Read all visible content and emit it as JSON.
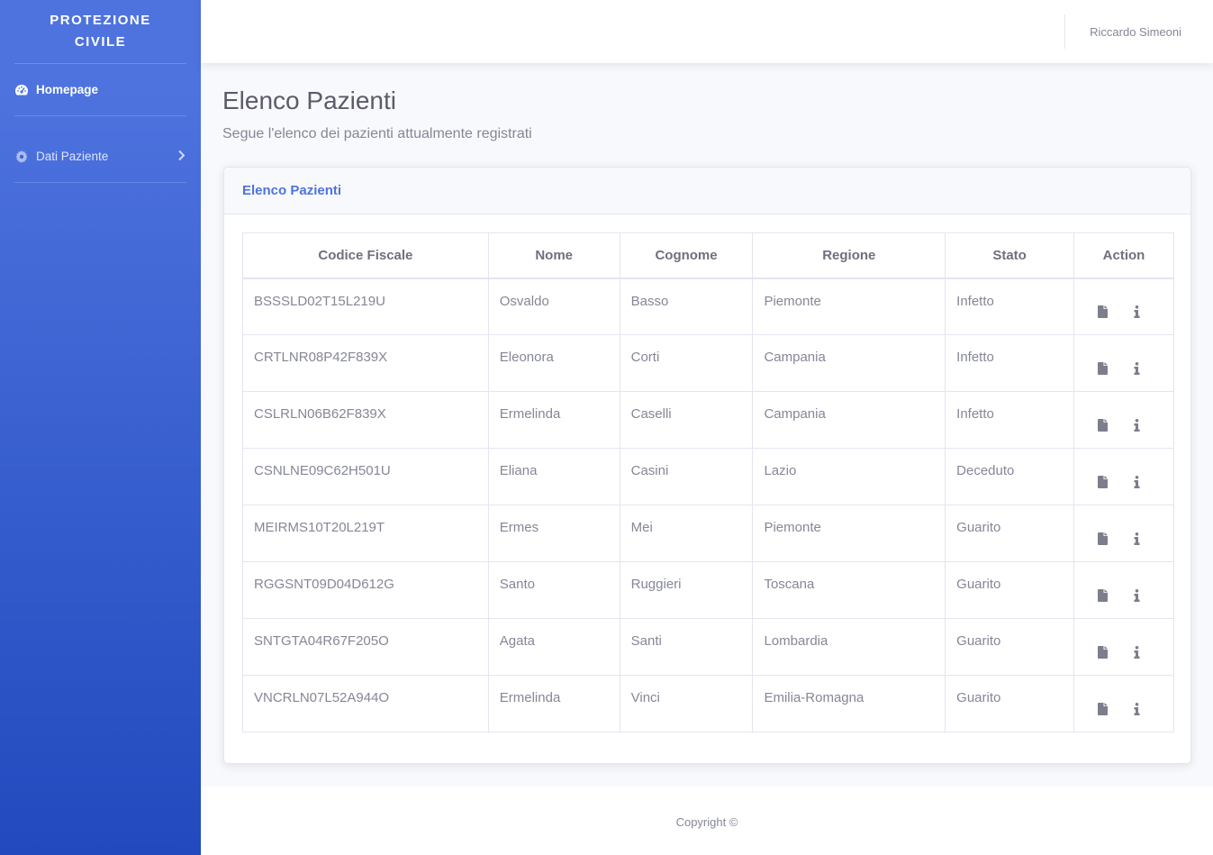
{
  "sidebar": {
    "brand_line1": "PROTEZIONE",
    "brand_line2": "CIVILE",
    "items": [
      {
        "label": "Homepage",
        "icon": "tachometer-icon"
      },
      {
        "label": "Dati Paziente",
        "icon": "gear-icon"
      }
    ]
  },
  "topbar": {
    "user_name": "Riccardo Simeoni"
  },
  "main": {
    "title": "Elenco Pazienti",
    "subtitle": "Segue l'elenco dei pazienti attualmente registrati",
    "card_title": "Elenco Pazienti"
  },
  "table": {
    "headers": [
      "Codice Fiscale",
      "Nome",
      "Cognome",
      "Regione",
      "Stato",
      "Action"
    ],
    "rows": [
      [
        "BSSSLD02T15L219U",
        "Osvaldo",
        "Basso",
        "Piemonte",
        "Infetto"
      ],
      [
        "CRTLNR08P42F839X",
        "Eleonora",
        "Corti",
        "Campania",
        "Infetto"
      ],
      [
        "CSLRLN06B62F839X",
        "Ermelinda",
        "Caselli",
        "Campania",
        "Infetto"
      ],
      [
        "CSNLNE09C62H501U",
        "Eliana",
        "Casini",
        "Lazio",
        "Deceduto"
      ],
      [
        "MEIRMS10T20L219T",
        "Ermes",
        "Mei",
        "Piemonte",
        "Guarito"
      ],
      [
        "RGGSNT09D04D612G",
        "Santo",
        "Ruggieri",
        "Toscana",
        "Guarito"
      ],
      [
        "SNTGTA04R67F205O",
        "Agata",
        "Santi",
        "Lombardia",
        "Guarito"
      ],
      [
        "VNCRLN07L52A944O",
        "Ermelinda",
        "Vinci",
        "Emilia-Romagna",
        "Guarito"
      ]
    ]
  },
  "footer": {
    "copyright": "Copyright ©"
  },
  "colors": {
    "primary": "#4e73df",
    "sidebar_bottom": "#224abe",
    "text": "#858796"
  }
}
